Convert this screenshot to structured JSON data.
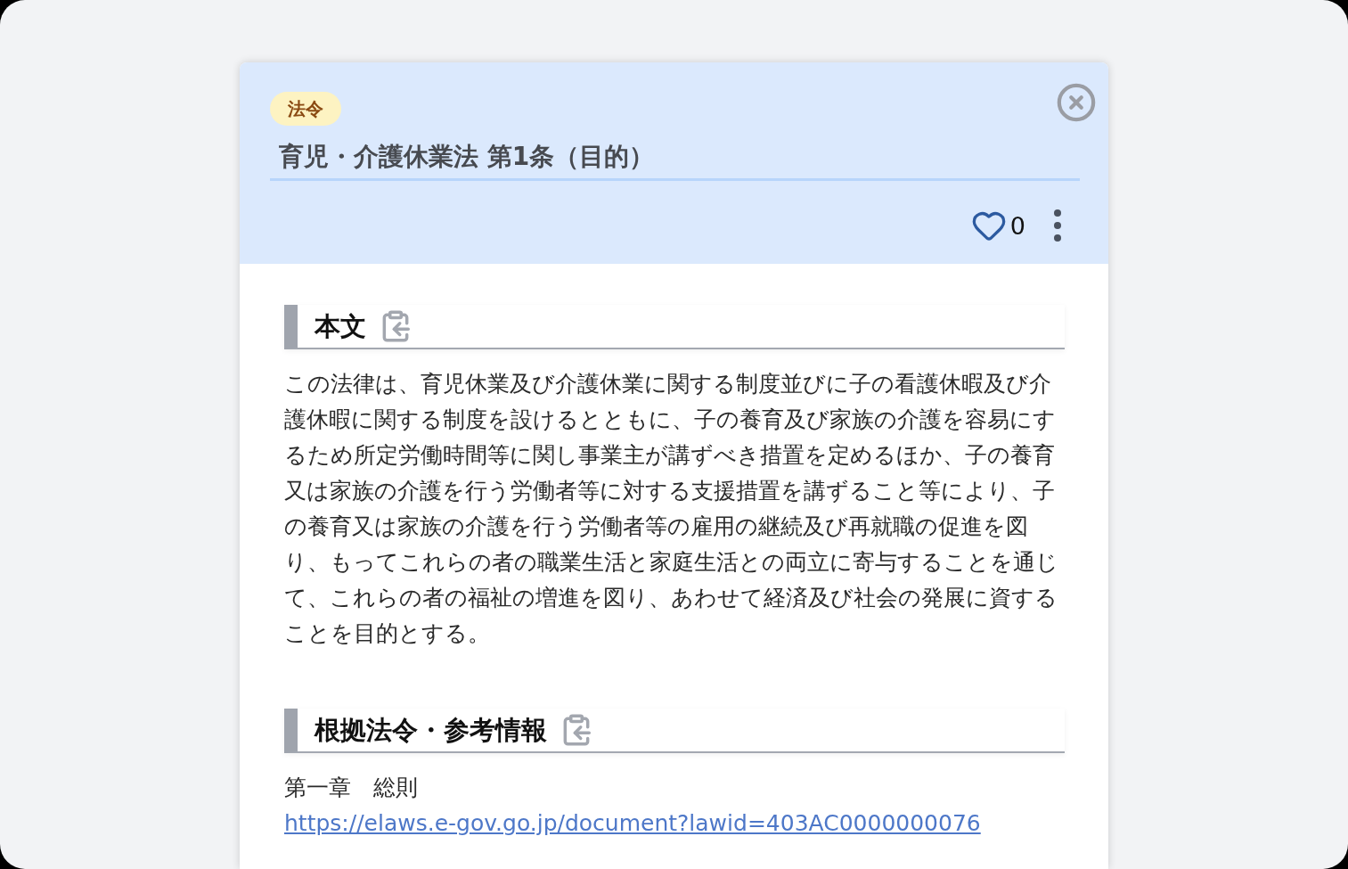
{
  "badge": "法令",
  "title": "育児・介護休業法 第1条（目的）",
  "likes": {
    "count": "0",
    "liked": false
  },
  "sections": [
    {
      "heading": "本文",
      "body": [
        {
          "kind": "text",
          "text": "この法律は、育児休業及び介護休業に関する制度並びに子の看護休暇及び介護休暇に関する制度を設けるとともに、子の養育及び家族の介護を容易にするため所定労働時間等に関し事業主が講ずべき措置を定めるほか、子の養育又は家族の介護を行う労働者等に対する支援措置を講ずること等により、子の養育又は家族の介護を行う労働者等の雇用の継続及び再就職の促進を図り、もってこれらの者の職業生活と家庭生活との両立に寄与することを通じて、これらの者の福祉の増進を図り、あわせて経済及び社会の発展に資することを目的とする。"
        }
      ]
    },
    {
      "heading": "根拠法令・参考情報",
      "body": [
        {
          "kind": "text",
          "text": "第一章　総則"
        },
        {
          "kind": "link",
          "text": "https://elaws.e-gov.go.jp/document?lawid=403AC0000000076"
        }
      ]
    }
  ]
}
